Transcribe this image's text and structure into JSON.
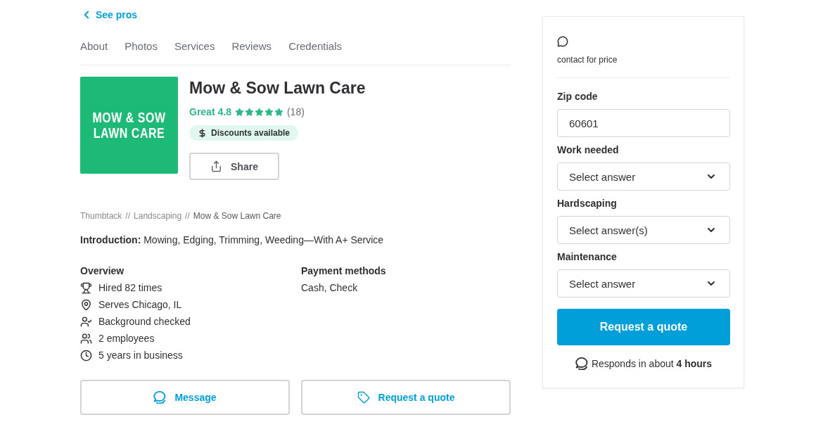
{
  "back_link": {
    "label": "See pros"
  },
  "tabs": [
    {
      "label": "About",
      "selected": false
    },
    {
      "label": "Photos",
      "selected": false
    },
    {
      "label": "Services",
      "selected": false
    },
    {
      "label": "Reviews",
      "selected": false
    },
    {
      "label": "Credentials",
      "selected": false
    }
  ],
  "profile": {
    "logo": {
      "lines": [
        "MOW & SOW",
        "LAWN CARE"
      ]
    },
    "name": "Mow & Sow Lawn Care",
    "rating": {
      "label": "Great 4.8",
      "stars": 5,
      "count": "(18)"
    },
    "badge": {
      "label": "Discounts available"
    },
    "share_button": {
      "label": "Share"
    }
  },
  "breadcrumb": [
    {
      "kind": "link",
      "label": "Thumbtack"
    },
    {
      "kind": "separator",
      "label": "//"
    },
    {
      "kind": "link",
      "label": "Landscaping"
    },
    {
      "kind": "separator",
      "label": "//"
    },
    {
      "kind": "current",
      "label": "Mow & Sow Lawn Care"
    }
  ],
  "introduction": "**Introduction:** Mowing, Edging, Trimming, Weeding—With A+ Service",
  "overview": {
    "title": "Overview",
    "items": [
      "Hired 82 times",
      "Serves Chicago, IL",
      "Background checked",
      "2 employees",
      "5 years in business"
    ]
  },
  "payment": {
    "title": "Payment methods",
    "text": "Cash, Check"
  },
  "actions": [
    {
      "label": "Message"
    },
    {
      "label": "Request a quote"
    }
  ],
  "quote_card": {
    "price_note": "contact for price",
    "fields": [
      {
        "kind": "text",
        "label": "Zip code",
        "value": "60601"
      },
      {
        "kind": "select",
        "label": "Work needed",
        "placeholder": "Select answer"
      },
      {
        "kind": "select",
        "label": "Hardscaping",
        "placeholder": "Select answer(s)"
      },
      {
        "kind": "select",
        "label": "Maintenance",
        "placeholder": "Select answer"
      }
    ],
    "submit": "Request a quote",
    "response_note": "Responds in about **4 hours**"
  }
}
